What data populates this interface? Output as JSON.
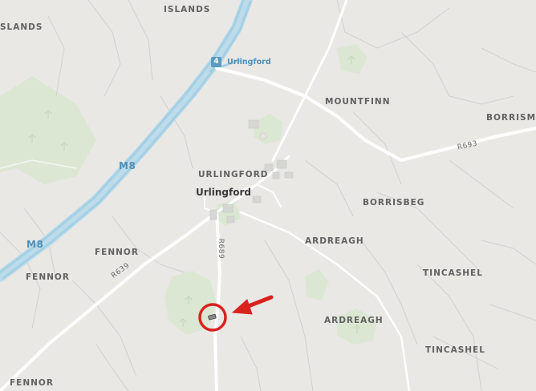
{
  "map": {
    "motorway": {
      "name": "M8",
      "junction_number": "4",
      "junction_name": "Urlingford"
    },
    "road_labels": {
      "r693": "R693",
      "r639": "R639",
      "r689": "R689"
    },
    "place_labels": {
      "islands_top": "ISLANDS",
      "islands_left": "SLANDS",
      "mountfinn": "MOUNTFINN",
      "borrismo": "BORRISMO",
      "urlingford_townland": "URLINGFORD",
      "urlingford_town": "Urlingford",
      "borrisbeg": "BORRISBEG",
      "ardreagh_1": "ARDREAGH",
      "ardreagh_2": "ARDREAGH",
      "fennor_1": "FENNOR",
      "fennor_2": "FENNOR",
      "fennor_3": "FENNOR",
      "tincashel_1": "TINCASHEL",
      "tincashel_2": "TINCASHEL"
    },
    "marker": {
      "type": "location-circle",
      "color": "#d9231f"
    },
    "colors": {
      "background": "#e9e8e5",
      "green_area": "#d7e6cf",
      "motorway": "#a7d3e6",
      "road": "#ffffff",
      "boundary": "#d2d2d2"
    }
  }
}
